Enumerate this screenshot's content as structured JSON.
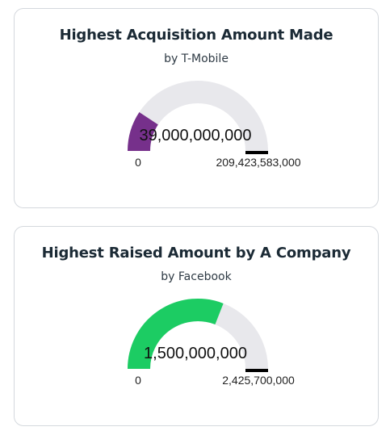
{
  "cards": [
    {
      "title": "Highest Acquisition Amount Made",
      "subtitle": "by T-Mobile",
      "gauge": {
        "value": 39000000000,
        "value_label": "39,000,000,000",
        "min_label": "0",
        "max_label": "209,423,583,000",
        "min": 0,
        "max": 209423583000,
        "target": 209423583000,
        "fill_color": "#76308b",
        "track_color": "#e8e8ec",
        "target_color": "#000000"
      }
    },
    {
      "title": "Highest Raised Amount by A Company",
      "subtitle": "by Facebook",
      "gauge": {
        "value": 1500000000,
        "value_label": "1,500,000,000",
        "min_label": "0",
        "max_label": "2,425,700,000",
        "min": 0,
        "max": 2425700000,
        "target": 2425700000,
        "fill_color": "#1ccc63",
        "track_color": "#e8e8ec",
        "target_color": "#000000"
      }
    }
  ]
}
